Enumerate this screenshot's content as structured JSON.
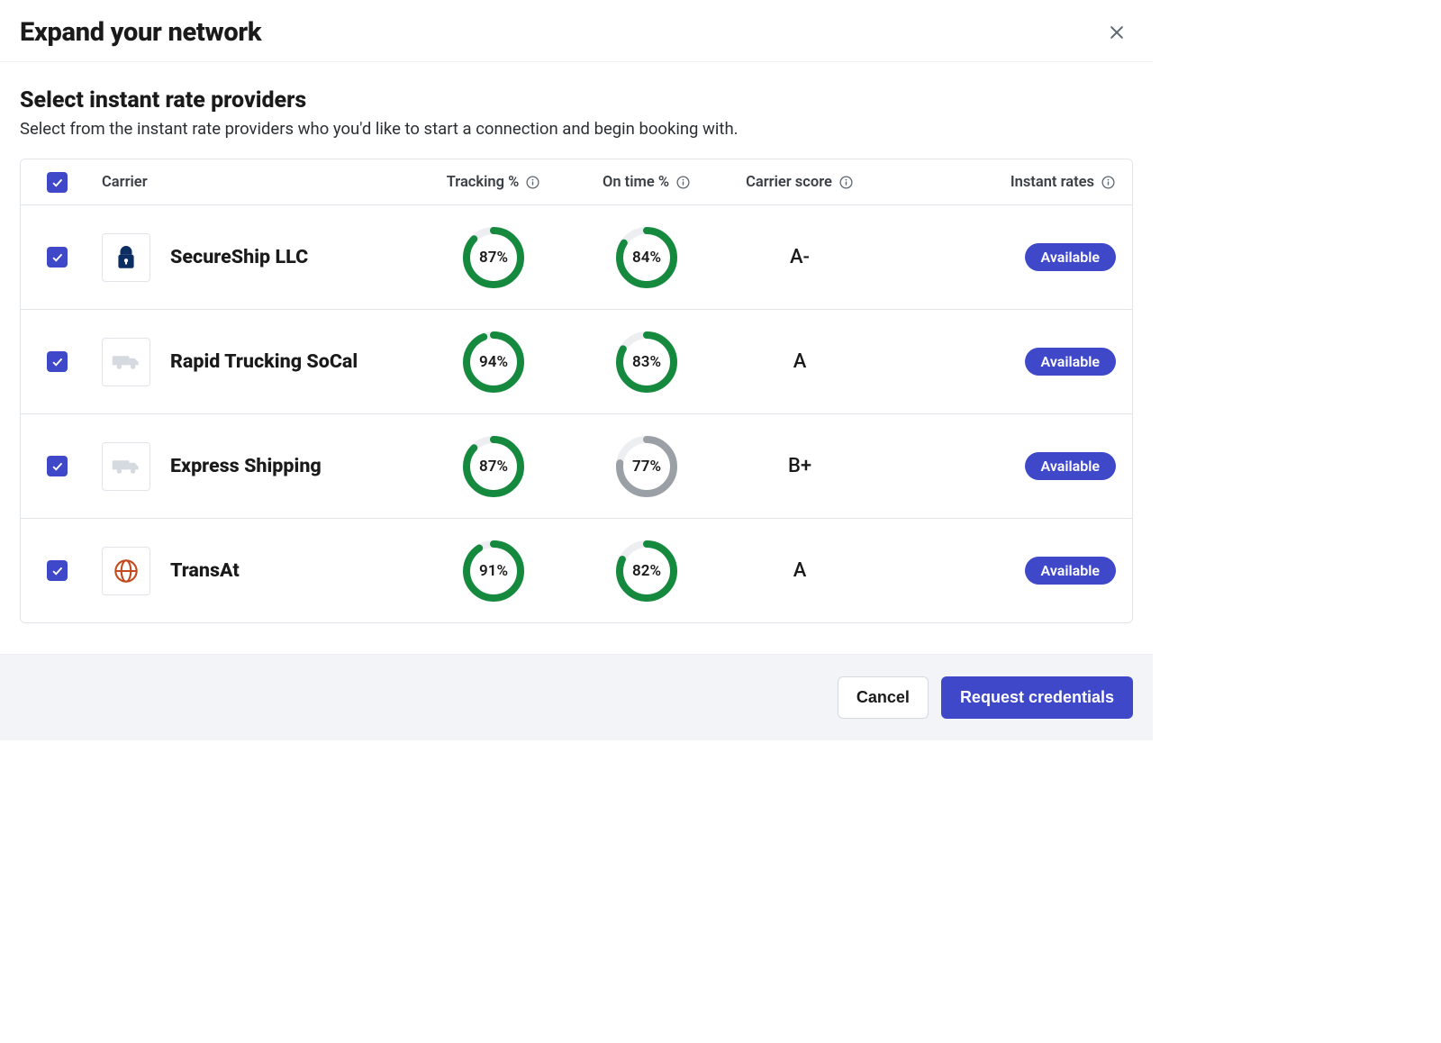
{
  "colors": {
    "brand": "#3f48c8",
    "donut_green": "#158a3e",
    "donut_gray": "#9aa0a6",
    "track": "#eceef1"
  },
  "modal": {
    "title": "Expand your network"
  },
  "section": {
    "title": "Select instant rate providers",
    "subtitle": "Select from the instant rate providers who you'd like to start a connection and begin booking with."
  },
  "columns": {
    "carrier": "Carrier",
    "tracking": "Tracking %",
    "ontime": "On time %",
    "score": "Carrier score",
    "rates": "Instant rates"
  },
  "header_checked": true,
  "carriers": [
    {
      "checked": true,
      "icon": "lock",
      "name": "SecureShip LLC",
      "tracking_pct": 87,
      "tracking_label": "87%",
      "tracking_color": "green",
      "ontime_pct": 84,
      "ontime_label": "84%",
      "ontime_color": "green",
      "score": "A-",
      "rate_status": "Available"
    },
    {
      "checked": true,
      "icon": "truck",
      "name": "Rapid Trucking SoCal",
      "tracking_pct": 94,
      "tracking_label": "94%",
      "tracking_color": "green",
      "ontime_pct": 83,
      "ontime_label": "83%",
      "ontime_color": "green",
      "score": "A",
      "rate_status": "Available"
    },
    {
      "checked": true,
      "icon": "truck",
      "name": "Express Shipping",
      "tracking_pct": 87,
      "tracking_label": "87%",
      "tracking_color": "green",
      "ontime_pct": 77,
      "ontime_label": "77%",
      "ontime_color": "gray",
      "score": "B+",
      "rate_status": "Available"
    },
    {
      "checked": true,
      "icon": "globe",
      "name": "TransAt",
      "tracking_pct": 91,
      "tracking_label": "91%",
      "tracking_color": "green",
      "ontime_pct": 82,
      "ontime_label": "82%",
      "ontime_color": "green",
      "score": "A",
      "rate_status": "Available"
    }
  ],
  "footer": {
    "cancel": "Cancel",
    "primary": "Request credentials"
  }
}
